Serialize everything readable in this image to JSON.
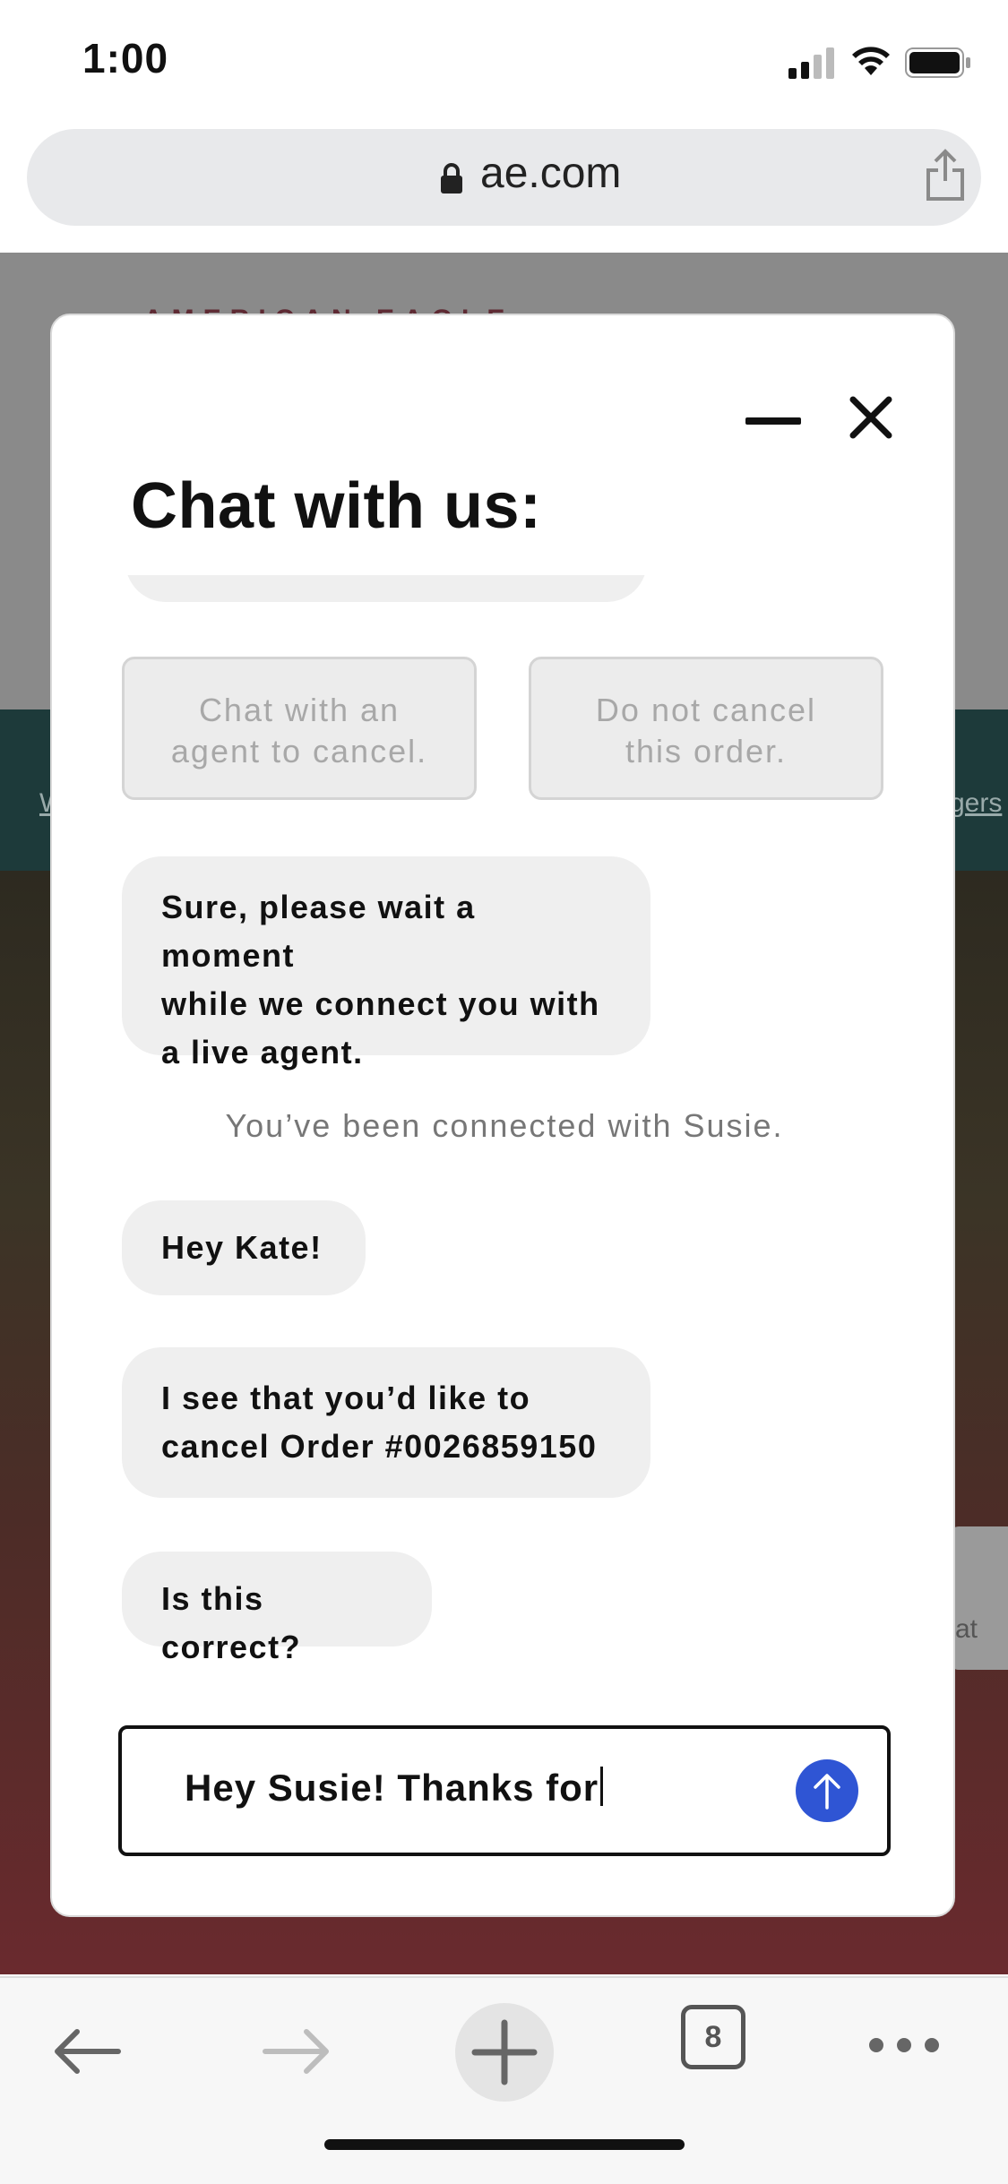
{
  "status_bar": {
    "time": "1:00"
  },
  "browser": {
    "address": "ae.com",
    "tab_count": "8"
  },
  "background_site": {
    "brand": "AMERICAN EAGLE",
    "band_link_left": "W",
    "band_link_right": "gers",
    "side_card_text": "at"
  },
  "chat": {
    "title": "Chat with us:",
    "options": [
      {
        "line1": "Chat with an",
        "line2": "agent to cancel."
      },
      {
        "line1": "Do not cancel",
        "line2": "this order."
      }
    ],
    "messages": [
      {
        "lines": [
          "Sure, please wait a moment",
          "while we connect you with",
          "a live agent."
        ]
      },
      {
        "lines": [
          "Hey Kate!"
        ]
      },
      {
        "lines": [
          "I see that you’d like to",
          "cancel Order #0026859150"
        ]
      },
      {
        "lines": [
          "Is this correct?"
        ]
      }
    ],
    "system_message": "You’ve been connected with Susie.",
    "input_value": "Hey Susie! Thanks for"
  },
  "colors": {
    "accent_send": "#2f55d4",
    "bubble_bg": "#efefef",
    "option_disabled_text": "#a8a8a8"
  },
  "icons": [
    "lock-icon",
    "share-icon",
    "minimize-icon",
    "close-icon",
    "send-arrow-icon",
    "back-arrow-icon",
    "forward-arrow-icon",
    "plus-icon",
    "tabs-icon",
    "more-icon"
  ]
}
